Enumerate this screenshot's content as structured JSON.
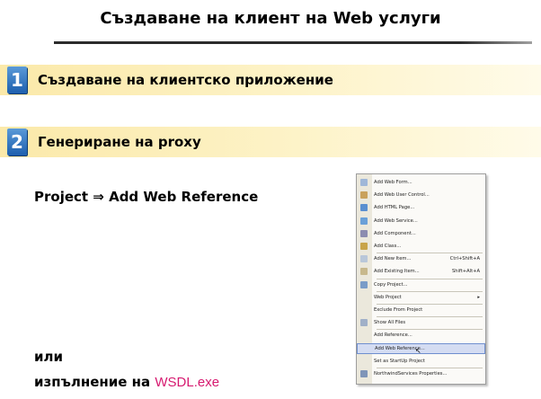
{
  "title": "Създаване на клиент на Web услуги",
  "steps": [
    {
      "num": "1",
      "label": "Създаване на клиентско приложение"
    },
    {
      "num": "2",
      "label": "Генериране на proxy"
    }
  ],
  "project_line": "Project ⇒ Add Web Reference",
  "or_text": "или",
  "exec_text": "изпълнение на ",
  "exec_link": "WSDL.exe",
  "colors": {
    "step_bg": "#fbe9a9",
    "step_num": "#1d5fae",
    "link": "#d6196f",
    "menu_highlight": "#d4dcf2"
  },
  "menu": {
    "items": [
      {
        "label": "Add Web Form...",
        "icon": "web-form-icon",
        "color": "#9fb7d8"
      },
      {
        "label": "Add Web User Control...",
        "icon": "user-control-icon",
        "color": "#c9a15c"
      },
      {
        "label": "Add HTML Page...",
        "icon": "html-page-icon",
        "color": "#5a8fd0"
      },
      {
        "label": "Add Web Service...",
        "icon": "web-service-icon",
        "color": "#6aa0d8"
      },
      {
        "label": "Add Component...",
        "icon": "component-icon",
        "color": "#8c8cb0"
      },
      {
        "label": "Add Class...",
        "icon": "class-icon",
        "color": "#c8a44a"
      },
      {
        "label": "Add New Item...",
        "shortcut": "Ctrl+Shift+A",
        "icon": "new-item-icon",
        "color": "#b9c7d9"
      },
      {
        "label": "Add Existing Item...",
        "shortcut": "Shift+Alt+A",
        "icon": "existing-item-icon",
        "color": "#c7b88c"
      },
      {
        "label": "Copy Project...",
        "icon": "copy-project-icon",
        "color": "#7a9cc8"
      },
      {
        "label": "Web Project",
        "arrow": "▸",
        "icon": "",
        "color": ""
      },
      {
        "label": "Exclude From Project",
        "icon": "",
        "color": ""
      },
      {
        "label": "Show All Files",
        "icon": "show-files-icon",
        "color": "#a0b0c8"
      },
      {
        "label": "Add Reference...",
        "icon": "",
        "color": ""
      },
      {
        "label": "Add Web Reference...",
        "icon": "",
        "color": "",
        "highlight": true
      },
      {
        "label": "Set as StartUp Project",
        "icon": "",
        "color": ""
      },
      {
        "label": "NorthwindServices Properties...",
        "icon": "properties-icon",
        "color": "#7f95b8"
      }
    ]
  }
}
